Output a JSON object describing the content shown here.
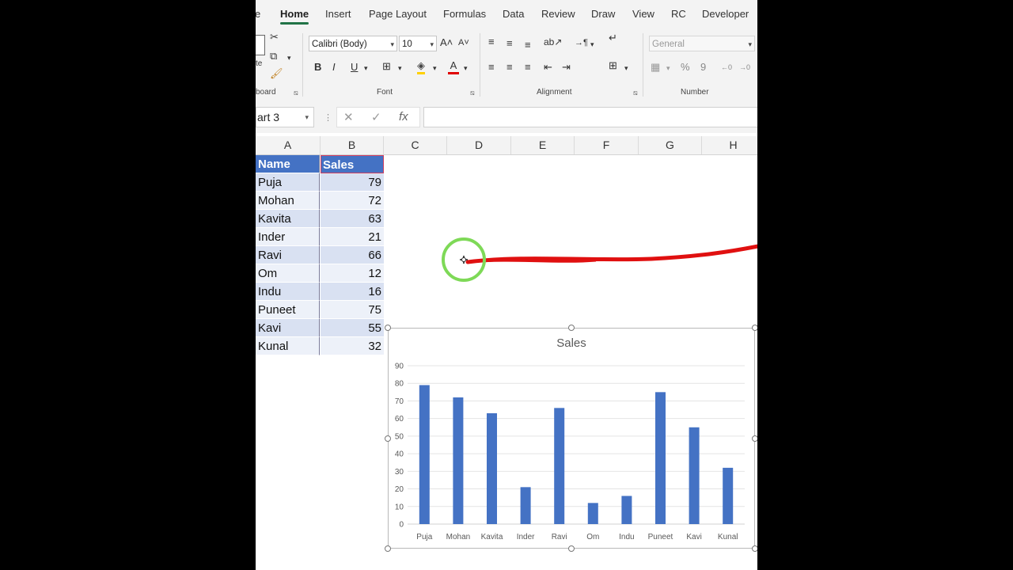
{
  "ribbon": {
    "tabs": [
      {
        "label": "e"
      },
      {
        "label": "Home"
      },
      {
        "label": "Insert"
      },
      {
        "label": "Page Layout"
      },
      {
        "label": "Formulas"
      },
      {
        "label": "Data"
      },
      {
        "label": "Review"
      },
      {
        "label": "Draw"
      },
      {
        "label": "View"
      },
      {
        "label": "RC"
      },
      {
        "label": "Developer"
      }
    ],
    "active_tab": "Home",
    "clipboard": {
      "label": "board",
      "paste_label": "te"
    },
    "font": {
      "label": "Font",
      "name": "Calibri (Body)",
      "size": "10"
    },
    "alignment": {
      "label": "Alignment"
    },
    "number": {
      "label": "Number",
      "format": "General"
    }
  },
  "formula_bar": {
    "name_box": "art 3",
    "cancel": "✕",
    "enter": "✓",
    "fx": "fx",
    "value": ""
  },
  "sheet": {
    "columns": [
      "A",
      "B",
      "C",
      "D",
      "E",
      "F",
      "G",
      "H"
    ],
    "header": {
      "a": "Name",
      "b": "Sales"
    },
    "rows": [
      {
        "name": "Puja",
        "sales": "79"
      },
      {
        "name": "Mohan",
        "sales": "72"
      },
      {
        "name": "Kavita",
        "sales": "63"
      },
      {
        "name": "Inder",
        "sales": "21"
      },
      {
        "name": "Ravi",
        "sales": "66"
      },
      {
        "name": "Om",
        "sales": "12"
      },
      {
        "name": "Indu",
        "sales": "16"
      },
      {
        "name": "Puneet",
        "sales": "75"
      },
      {
        "name": "Kavi",
        "sales": "55"
      },
      {
        "name": "Kunal",
        "sales": "32"
      }
    ]
  },
  "colors": {
    "excel_green": "#217346",
    "bar": "#4472c4",
    "header_fill": "#4472c4",
    "annotation_arrow": "#e01010",
    "cursor_ring": "#7ed957"
  },
  "chart_data": {
    "type": "bar",
    "title": "Sales",
    "categories": [
      "Puja",
      "Mohan",
      "Kavita",
      "Inder",
      "Ravi",
      "Om",
      "Indu",
      "Puneet",
      "Kavi",
      "Kunal"
    ],
    "values": [
      79,
      72,
      63,
      21,
      66,
      12,
      16,
      75,
      55,
      32
    ],
    "ylim": [
      0,
      90
    ],
    "yticks": [
      0,
      10,
      20,
      30,
      40,
      50,
      60,
      70,
      80,
      90
    ],
    "grid": true,
    "xlabel": "",
    "ylabel": ""
  }
}
